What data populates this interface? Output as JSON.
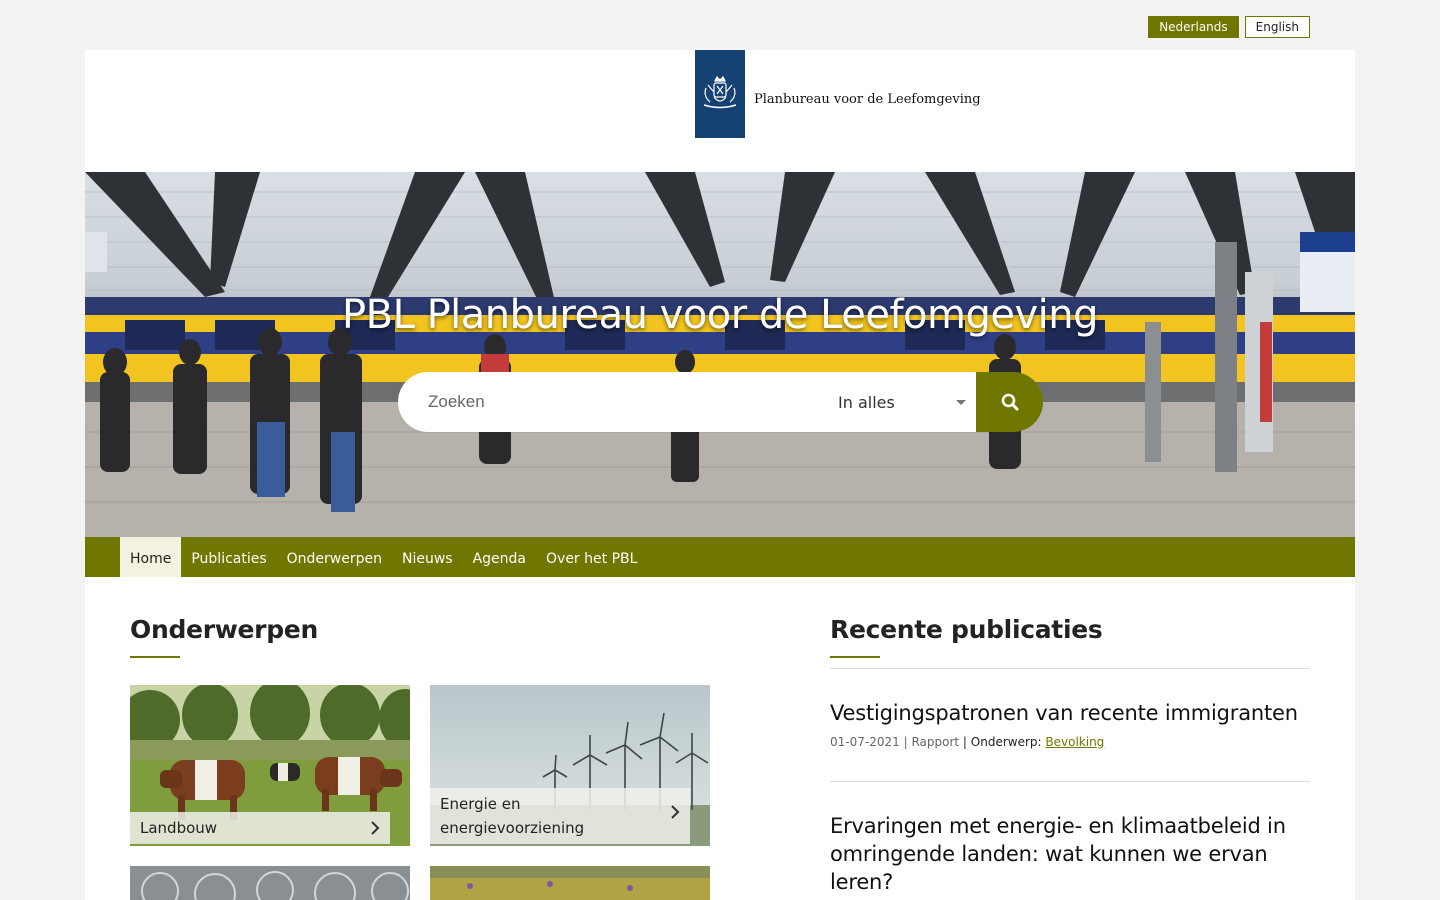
{
  "language": {
    "options": [
      {
        "label": "Nederlands",
        "active": true
      },
      {
        "label": "English",
        "active": false
      }
    ]
  },
  "header": {
    "logo_text": "Planbureau voor de Leefomgeving",
    "logo_icon": "royal-coat-of-arms-icon"
  },
  "hero": {
    "title": "PBL Planbureau voor de Leefomgeving",
    "search_placeholder": "Zoeken",
    "search_scope": "In alles",
    "search_icon": "search-icon"
  },
  "nav": {
    "items": [
      "Home",
      "Publicaties",
      "Onderwerpen",
      "Nieuws",
      "Agenda",
      "Over het PBL"
    ],
    "active": "Home"
  },
  "onderwerpen": {
    "heading": "Onderwerpen",
    "tiles": [
      {
        "label": "Landbouw"
      },
      {
        "label": "Energie en energievoorziening"
      }
    ]
  },
  "recent": {
    "heading": "Recente publicaties",
    "items": [
      {
        "title": "Vestigingspatronen van recente immigranten",
        "date": "01-07-2021",
        "type": "Rapport",
        "subject_label": "Onderwerp:",
        "subject": "Bevolking"
      },
      {
        "title": "Ervaringen met energie- en klimaatbeleid in omringende landen: wat kunnen we ervan leren?"
      }
    ]
  },
  "colors": {
    "brand_green": "#6f7701",
    "rijksoverheid_blue": "#154273"
  }
}
